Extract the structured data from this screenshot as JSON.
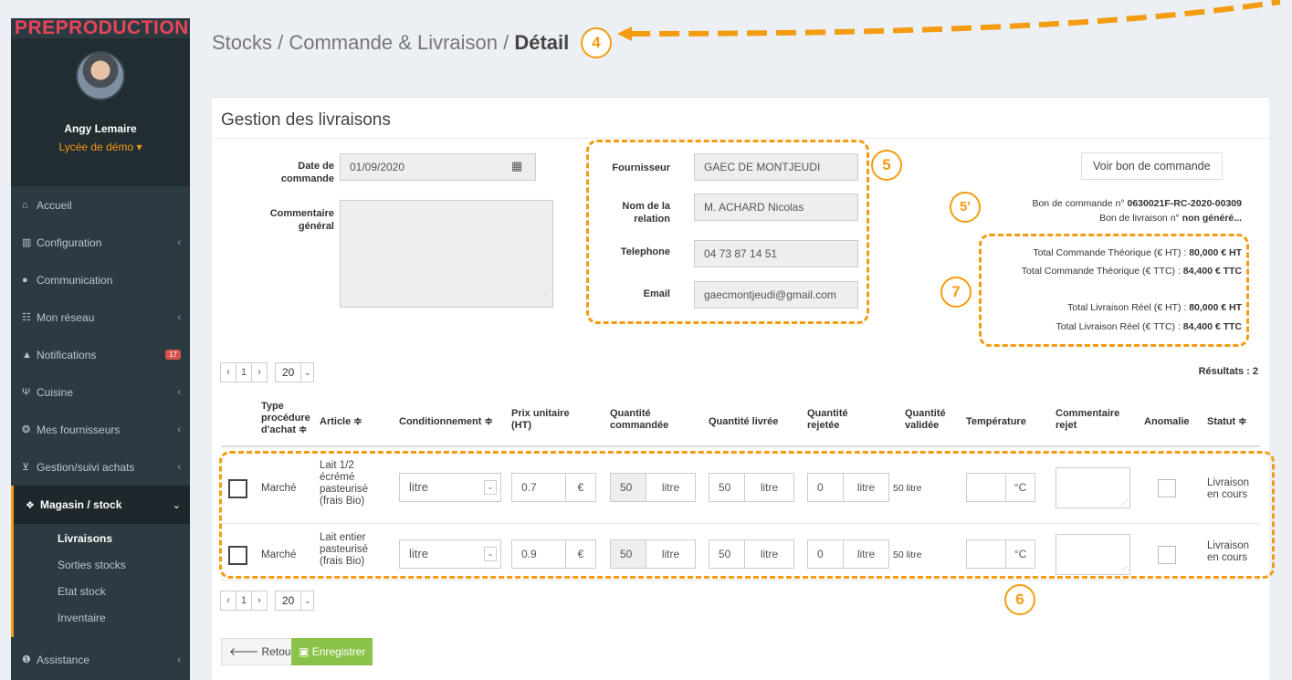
{
  "sidebar": {
    "env_label": "PREPRODUCTION",
    "user_name": "Angy Lemaire",
    "school": "Lycée de démo ▾",
    "items": [
      {
        "label": "Accueil"
      },
      {
        "label": "Configuration"
      },
      {
        "label": "Communication"
      },
      {
        "label": "Mon réseau"
      },
      {
        "label": "Notifications",
        "badge": "17"
      },
      {
        "label": "Cuisine"
      },
      {
        "label": "Mes fournisseurs"
      },
      {
        "label": "Gestion/suivi achats"
      },
      {
        "label": "Magasin / stock"
      }
    ],
    "sub_items": [
      "Livraisons",
      "Sorties stocks",
      "Etat stock",
      "Inventaire"
    ],
    "assistance": "Assistance"
  },
  "header": {
    "crumb": "Stocks / Commande & Livraison / ",
    "crumb_current": "Détail"
  },
  "box": {
    "title": "Gestion des livraisons",
    "order_date_label": "Date de commande",
    "order_date": "01/09/2020",
    "comment_label": "Commentaire général",
    "supplier_label": "Fournisseur",
    "supplier": "GAEC DE MONTJEUDI",
    "contact_label": "Nom de la relation",
    "contact": "M. ACHARD Nicolas",
    "phone_label": "Telephone",
    "phone": "04 73 87 14 51",
    "email_label": "Email",
    "email": "gaecmontjeudi@gmail.com",
    "view_order_button": "Voir bon de commande",
    "order_no_label": "Bon de commande n° ",
    "order_no": "0630021F-RC-2020-00309",
    "delivery_no_label": "Bon de livraison n° ",
    "delivery_no": "non généré...",
    "total_order_ht_label": "Total Commande Théorique (€ HT) : ",
    "total_order_ht": "80,000 € HT",
    "total_order_ttc_label": "Total Commande Théorique (€ TTC) : ",
    "total_order_ttc": "84,400 € TTC",
    "total_delivery_ht_label": "Total Livraison Réel (€ HT) : ",
    "total_delivery_ht": "80,000 € HT",
    "total_delivery_ttc_label": "Total Livraison Réel (€ TTC) : ",
    "total_delivery_ttc": "84,400 € TTC",
    "results": "Résultats : 2",
    "pager": {
      "prev": "‹",
      "page": "1",
      "next": "›",
      "per_page": "20"
    },
    "back_button": "Retour",
    "save_button": "Enregistrer"
  },
  "table": {
    "headers": {
      "type": "Type procédure d'achat ≑",
      "article": "Article ≑",
      "cond": "Conditionnement ≑",
      "price": "Prix unitaire (HT)",
      "qty_ordered": "Quantité commandée",
      "qty_delivered": "Quantité livrée",
      "qty_rejected": "Quantité rejetée",
      "qty_validated": "Quantité validée",
      "temperature": "Température",
      "comment": "Commentaire rejet",
      "anomaly": "Anomalie",
      "status": "Statut ≑"
    },
    "rows": [
      {
        "type": "Marché",
        "article": "Lait 1/2 écrémé pasteurisé (frais Bio)",
        "cond": "litre",
        "price": "0.7",
        "currency": "€",
        "qty_ordered": "50",
        "unit": "litre",
        "qty_delivered": "50",
        "qty_rejected": "0",
        "qty_validated": "50 litre",
        "temp_unit": "°C",
        "status": "Livraison en cours"
      },
      {
        "type": "Marché",
        "article": "Lait entier pasteurisé (frais Bio)",
        "cond": "litre",
        "price": "0.9",
        "currency": "€",
        "qty_ordered": "50",
        "unit": "litre",
        "qty_delivered": "50",
        "qty_rejected": "0",
        "qty_validated": "50 litre",
        "temp_unit": "°C",
        "status": "Livraison en cours"
      }
    ]
  },
  "annotations": {
    "a4": "4",
    "a5": "5",
    "a5p": "5'",
    "a6": "6",
    "a7": "7"
  },
  "colors": {
    "accent": "#f39c12",
    "save": "#8bc34a",
    "sidebar": "#2c3b41",
    "preprod": "#e8445a"
  }
}
